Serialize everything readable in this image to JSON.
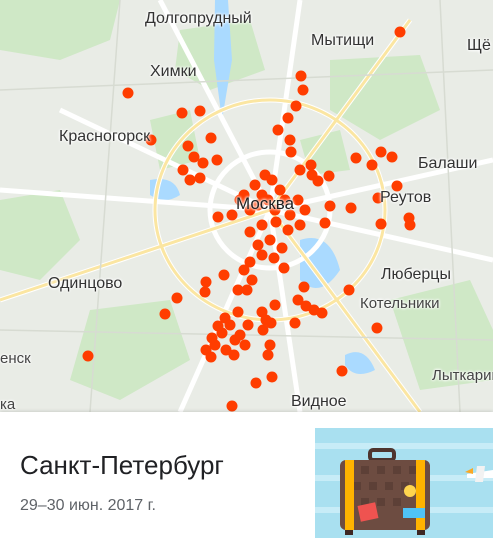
{
  "map": {
    "labels": {
      "dolgoprudny": "Долгопрудный",
      "mytishchi": "Мытищи",
      "shchelkovo": "Щё",
      "khimki": "Химки",
      "krasnogorsk": "Красногорск",
      "balashikha": "Балаши",
      "moskva": "Москва",
      "reutov": "Реутов",
      "odintsovo": "Одинцово",
      "lyubertsy": "Люберцы",
      "kotelniki": "Котельники",
      "enska": "енск",
      "ka": "ка",
      "lytkarino": "Лыткарино",
      "vidnoe": "Видное"
    },
    "marker_color": "#ff3d00"
  },
  "trip": {
    "title": "Санкт-Петербург",
    "dates": "29–30 июн. 2017 г."
  },
  "thumbnail": {
    "icon": "suitcase-icon",
    "bg_color": "#a9e0f0"
  }
}
